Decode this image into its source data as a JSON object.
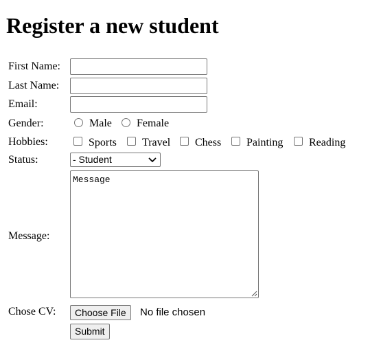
{
  "page": {
    "title": "Register a new student"
  },
  "form": {
    "first_name": {
      "label": "First Name:",
      "value": ""
    },
    "last_name": {
      "label": "Last Name:",
      "value": ""
    },
    "email": {
      "label": "Email:",
      "value": ""
    },
    "gender": {
      "label": "Gender:",
      "options": [
        "Male",
        "Female"
      ],
      "selected": null
    },
    "hobbies": {
      "label": "Hobbies:",
      "options": [
        "Sports",
        "Travel",
        "Chess",
        "Painting",
        "Reading"
      ],
      "checked": []
    },
    "status": {
      "label": "Status:",
      "selected": "- Student"
    },
    "message": {
      "label": "Message:",
      "placeholder": "Message"
    },
    "cv": {
      "label": "Chose CV:",
      "button_label": "Choose File",
      "file_status": "No file chosen"
    },
    "submit_label": "Submit"
  }
}
